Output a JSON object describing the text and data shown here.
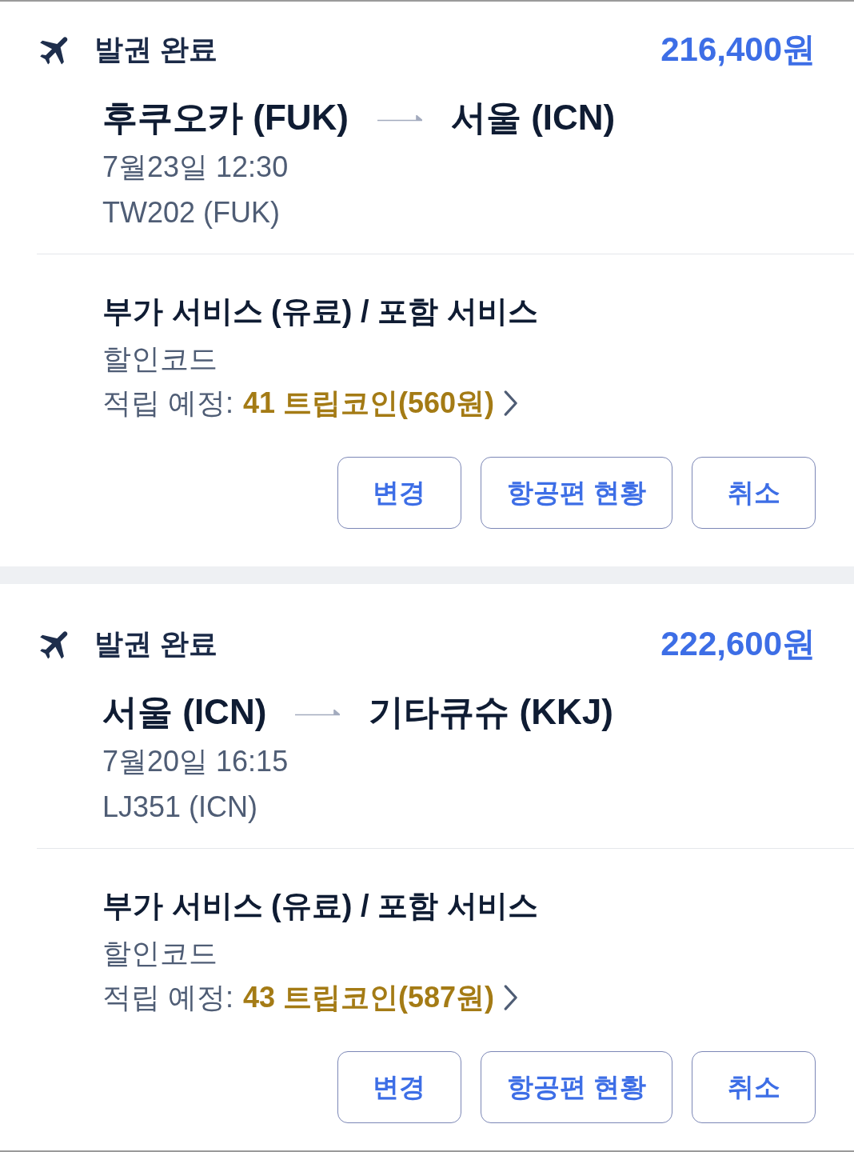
{
  "bookings": [
    {
      "status": "발권 완료",
      "price": "216,400원",
      "route": {
        "from": "후쿠오카 (FUK)",
        "to": "서울 (ICN)"
      },
      "departure": "7월23일 12:30",
      "flight": "TW202 (FUK)",
      "services_title": "부가 서비스 (유료) / 포함 서비스",
      "discount_code": "할인코드",
      "reward": {
        "label": "적립 예정:",
        "amount": "41 트립코인(560원)"
      },
      "buttons": [
        "변경",
        "항공편 현황",
        "취소"
      ]
    },
    {
      "status": "발권 완료",
      "price": "222,600원",
      "route": {
        "from": "서울 (ICN)",
        "to": "기타큐슈 (KKJ)"
      },
      "departure": "7월20일 16:15",
      "flight": "LJ351 (ICN)",
      "services_title": "부가 서비스 (유료) / 포함 서비스",
      "discount_code": "할인코드",
      "reward": {
        "label": "적립 예정:",
        "amount": "43 트립코인(587원)"
      },
      "buttons": [
        "변경",
        "항공편 현황",
        "취소"
      ]
    }
  ]
}
